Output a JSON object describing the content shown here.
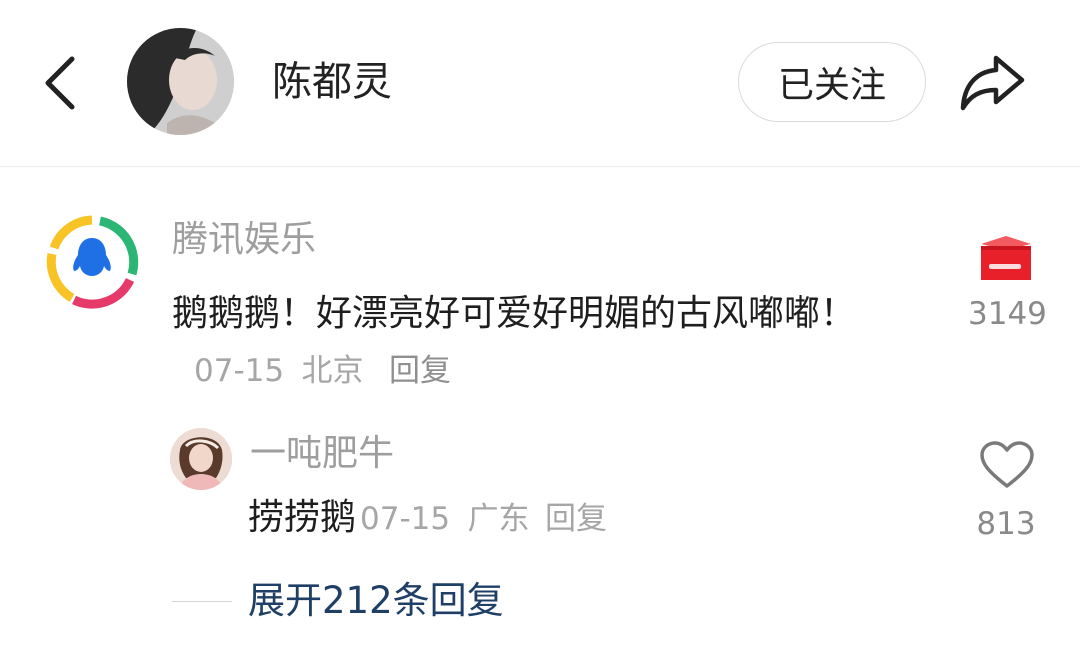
{
  "header": {
    "back_icon": "chevron-left-icon",
    "title": "陈都灵",
    "follow_label": "已关注",
    "share_icon": "share-arrow-icon"
  },
  "comment": {
    "author": "腾讯娱乐",
    "avatar_icon": "tencent-penguin-logo",
    "text": "鹅鹅鹅！好漂亮好可爱好明媚的古风嘟嘟！",
    "date": "07-15",
    "location": "北京",
    "reply_label": "回复",
    "reaction_icon": "gift-box-icon",
    "reaction_count": "3149",
    "reply": {
      "author": "一吨肥牛",
      "text": "捞捞鹅",
      "date": "07-15",
      "location": "广东",
      "reply_label": "回复",
      "like_icon": "heart-icon",
      "like_count": "813"
    },
    "expand_label": "展开212条回复"
  },
  "colors": {
    "link": "#1f3f66",
    "gift_red": "#e8202a",
    "muted": "#9e9e9e"
  }
}
